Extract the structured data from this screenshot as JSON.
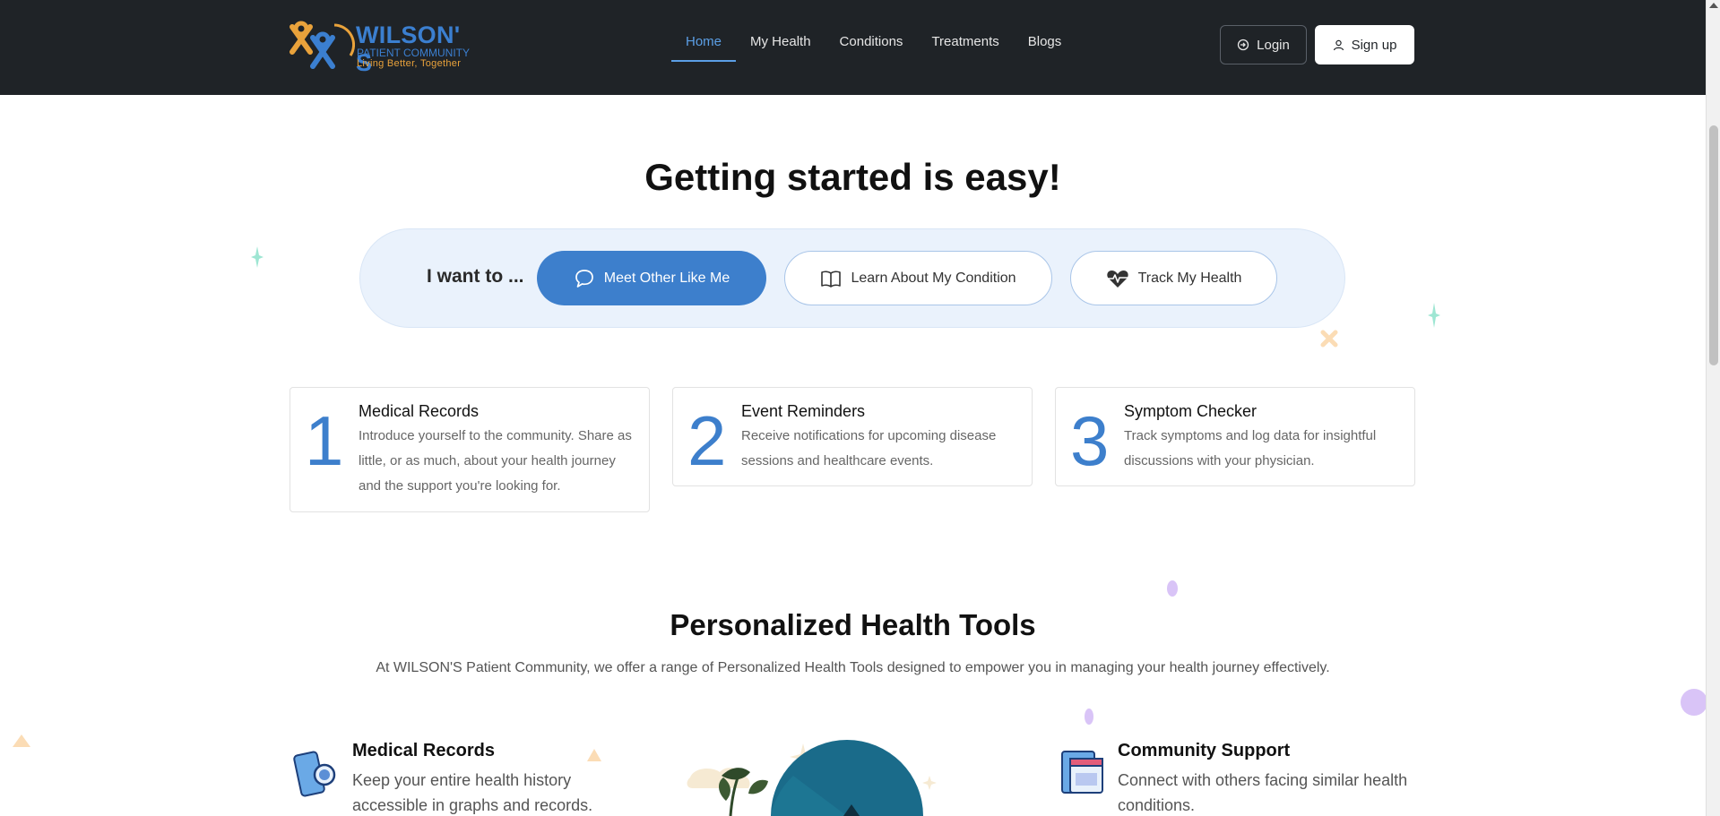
{
  "header": {
    "logo": {
      "name": "WILSON' S",
      "sub": "PATIENT COMMUNITY",
      "tagline": "Living Better, Together"
    },
    "nav": [
      {
        "label": "Home",
        "active": true
      },
      {
        "label": "My Health",
        "active": false
      },
      {
        "label": "Conditions",
        "active": false
      },
      {
        "label": "Treatments",
        "active": false
      },
      {
        "label": "Blogs",
        "active": false
      }
    ],
    "login_label": "Login",
    "signup_label": "Sign up"
  },
  "hero": {
    "title": "Getting started is easy!",
    "prompt": "I want to ...",
    "options": [
      {
        "label": "Meet Other Like Me",
        "icon": "chat-bubbles-icon",
        "selected": true
      },
      {
        "label": "Learn About My Condition",
        "icon": "open-book-icon",
        "selected": false
      },
      {
        "label": "Track My Health",
        "icon": "heart-pulse-icon",
        "selected": false
      }
    ]
  },
  "steps": [
    {
      "number": "1",
      "title": "Medical Records",
      "description": "Introduce yourself to the community. Share as little, or as much, about your health journey and the support you're looking for."
    },
    {
      "number": "2",
      "title": "Event Reminders",
      "description": "Receive notifications for upcoming disease sessions and healthcare events."
    },
    {
      "number": "3",
      "title": "Symptom Checker",
      "description": "Track symptoms and log data for insightful discussions with your physician."
    }
  ],
  "tools": {
    "title": "Personalized Health Tools",
    "subtitle": "At WILSON'S Patient Community, we offer a range of Personalized Health Tools designed to empower you in managing your health journey effectively.",
    "items": [
      {
        "title": "Medical Records",
        "description": "Keep your entire health history accessible in graphs and records.",
        "icon": "phone-magnifier-icon"
      },
      {
        "title": "Community Support",
        "description": "Connect with others facing similar health conditions.",
        "icon": "calendar-card-icon"
      }
    ]
  },
  "colors": {
    "header_bg": "#1f2327",
    "accent": "#3d7fcc",
    "pill_bg": "#eaf2fc",
    "logo_orange": "#e9a23b"
  }
}
